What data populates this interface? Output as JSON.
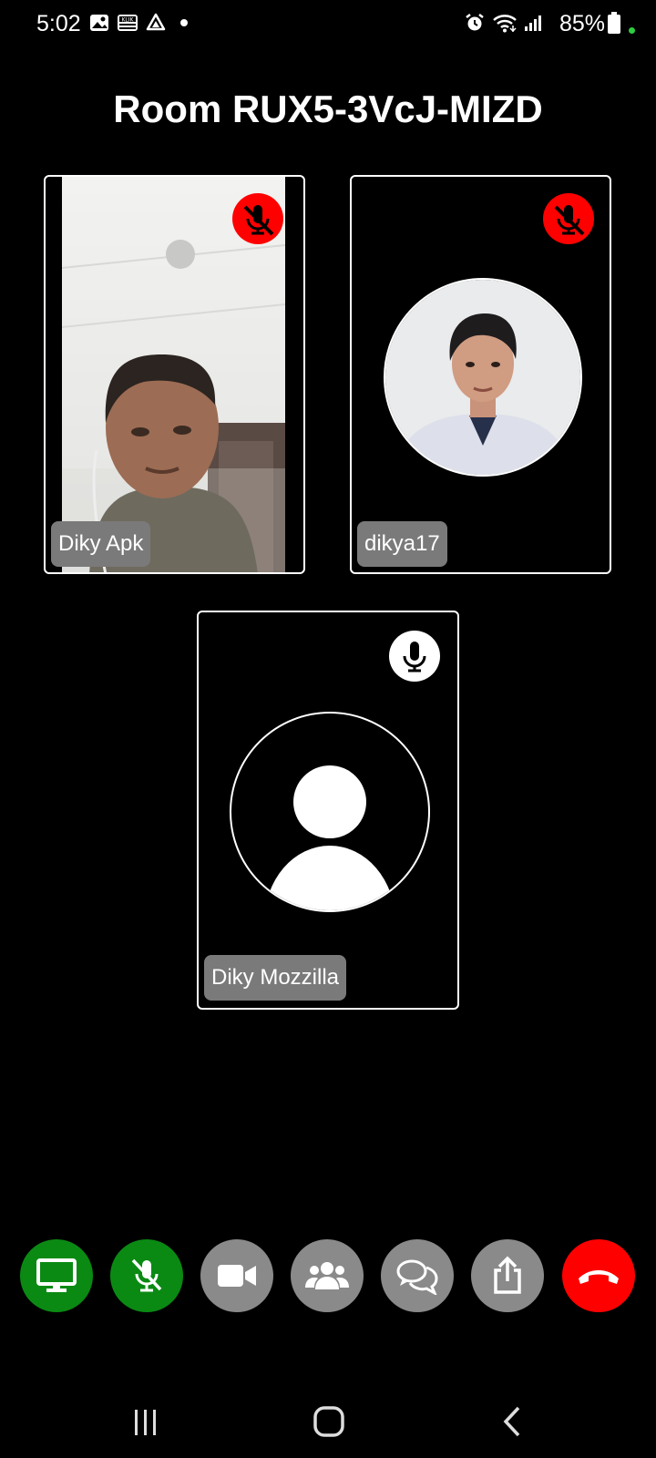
{
  "status_bar": {
    "time": "5:02",
    "battery": "85%",
    "icons": [
      "gallery-icon",
      "klik-icon",
      "drive-icon",
      "dot-icon",
      "alarm-icon",
      "wifi-icon",
      "signal-icon",
      "battery-icon"
    ]
  },
  "room": {
    "title": "Room RUX5-3VcJ-MIZD"
  },
  "participants": [
    {
      "name": "Diky Apk",
      "mic": "muted",
      "video": "camera-feed"
    },
    {
      "name": "dikya17",
      "mic": "muted",
      "video": "avatar-photo"
    },
    {
      "name": "Diky Mozzilla",
      "mic": "active",
      "video": "default-avatar"
    }
  ],
  "controls": [
    {
      "name": "screen-share-button",
      "icon": "monitor-icon",
      "color": "#0a8a13"
    },
    {
      "name": "mic-toggle-button",
      "icon": "mic-off-icon",
      "color": "#0a8a13"
    },
    {
      "name": "camera-toggle-button",
      "icon": "video-camera-icon",
      "color": "#8a8a8a"
    },
    {
      "name": "participants-button",
      "icon": "people-icon",
      "color": "#8a8a8a"
    },
    {
      "name": "chat-button",
      "icon": "chat-icon",
      "color": "#8a8a8a"
    },
    {
      "name": "share-button",
      "icon": "share-icon",
      "color": "#8a8a8a"
    },
    {
      "name": "end-call-button",
      "icon": "hang-up-icon",
      "color": "#ff0000"
    }
  ],
  "navigation": [
    "recent-apps-icon",
    "home-icon",
    "back-icon"
  ]
}
